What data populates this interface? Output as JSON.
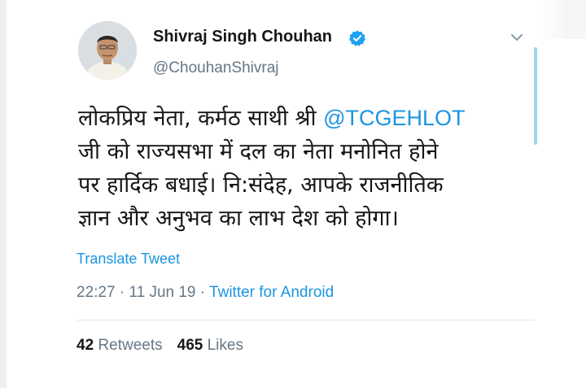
{
  "tweet": {
    "author_name": "Shivraj Singh Chouhan",
    "author_handle": "@ChouhanShivraj",
    "body_lines": [
      "लोकप्रिय नेता, कर्मठ साथी श्री ",
      "जी को राज्यसभा में दल का नेता मनोनित होने",
      "पर हार्दिक बधाई। नि:संदेह, आपके राजनीतिक",
      "ज्ञान और अनुभव का लाभ देश को होगा।"
    ],
    "mention": "@TCGEHLOT",
    "translate_label": "Translate Tweet",
    "time": "22:27",
    "separator": "·",
    "date": "11 Jun 19",
    "source": "Twitter for Android",
    "retweet_count": "42",
    "retweet_label": "Retweets",
    "like_count": "465",
    "like_label": "Likes"
  },
  "colors": {
    "link": "#1b95e0",
    "secondary_text": "#657786",
    "primary_text": "#14171a",
    "verified_badge": "#1da1f2"
  },
  "icons": {
    "verified": "verified-badge-icon",
    "menu": "chevron-down-icon"
  }
}
